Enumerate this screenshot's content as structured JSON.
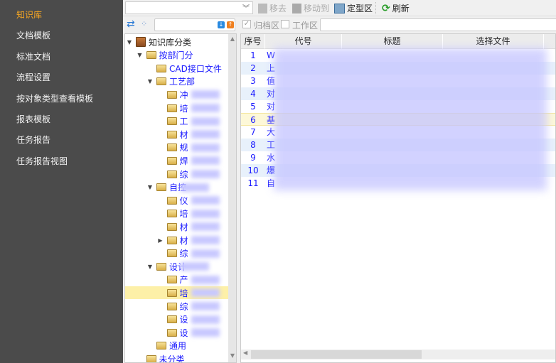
{
  "sidebar": {
    "items": [
      {
        "label": "知识库",
        "active": true
      },
      {
        "label": "文档模板"
      },
      {
        "label": "标准文档"
      },
      {
        "label": "流程设置"
      },
      {
        "label": "按对象类型查看模板"
      },
      {
        "label": "报表模板"
      },
      {
        "label": "任务报告"
      },
      {
        "label": "任务报告视图"
      }
    ]
  },
  "toolbar": {
    "remove": "移去",
    "move_to": "移动到",
    "fixed_area": "定型区",
    "refresh": "刷新"
  },
  "filter": {
    "archive": "归档区",
    "work": "工作区",
    "archive_checked": true,
    "work_checked": false
  },
  "tree": {
    "nodes": [
      {
        "label": "知识库分类",
        "level": 0,
        "expanded": true
      },
      {
        "label": "按部门分",
        "level": 1,
        "expanded": true
      },
      {
        "label": "CAD接口文件",
        "level": 2
      },
      {
        "label": "工艺部",
        "level": 2,
        "expanded": true
      },
      {
        "label": "冲",
        "level": 3,
        "blurred": true
      },
      {
        "label": "培",
        "level": 3,
        "blurred": true
      },
      {
        "label": "工",
        "level": 3,
        "blurred": true
      },
      {
        "label": "材",
        "level": 3,
        "blurred": true
      },
      {
        "label": "规",
        "level": 3,
        "blurred": true
      },
      {
        "label": "焊",
        "level": 3,
        "blurred": true
      },
      {
        "label": "综",
        "level": 3,
        "blurred": true
      },
      {
        "label": "自控",
        "level": 2,
        "expanded": true,
        "blurred": true
      },
      {
        "label": "仪",
        "level": 3,
        "blurred": true
      },
      {
        "label": "培",
        "level": 3,
        "blurred": true
      },
      {
        "label": "材",
        "level": 3,
        "blurred": true
      },
      {
        "label": "材",
        "level": 3,
        "collapsed": true,
        "blurred": true
      },
      {
        "label": "综",
        "level": 3,
        "blurred": true
      },
      {
        "label": "设计",
        "level": 2,
        "expanded": true,
        "blurred": true
      },
      {
        "label": "产",
        "level": 3,
        "blurred": true
      },
      {
        "label": "培",
        "level": 3,
        "blurred": true,
        "selected": true
      },
      {
        "label": "综",
        "level": 3,
        "blurred": true
      },
      {
        "label": "设",
        "level": 3,
        "blurred": true
      },
      {
        "label": "设",
        "level": 3,
        "blurred": true
      },
      {
        "label": "通用",
        "level": 2
      },
      {
        "label": "未分类",
        "level": 1
      }
    ]
  },
  "grid": {
    "columns": [
      "序号",
      "代号",
      "标题",
      "选择文件"
    ],
    "rows": [
      {
        "n": "1",
        "c": "W"
      },
      {
        "n": "2",
        "c": "上"
      },
      {
        "n": "3",
        "c": "值"
      },
      {
        "n": "4",
        "c": "对"
      },
      {
        "n": "5",
        "c": "对"
      },
      {
        "n": "6",
        "c": "基"
      },
      {
        "n": "7",
        "c": "大"
      },
      {
        "n": "8",
        "c": "工"
      },
      {
        "n": "9",
        "c": "水"
      },
      {
        "n": "10",
        "c": "爆"
      },
      {
        "n": "11",
        "c": "自"
      }
    ]
  }
}
